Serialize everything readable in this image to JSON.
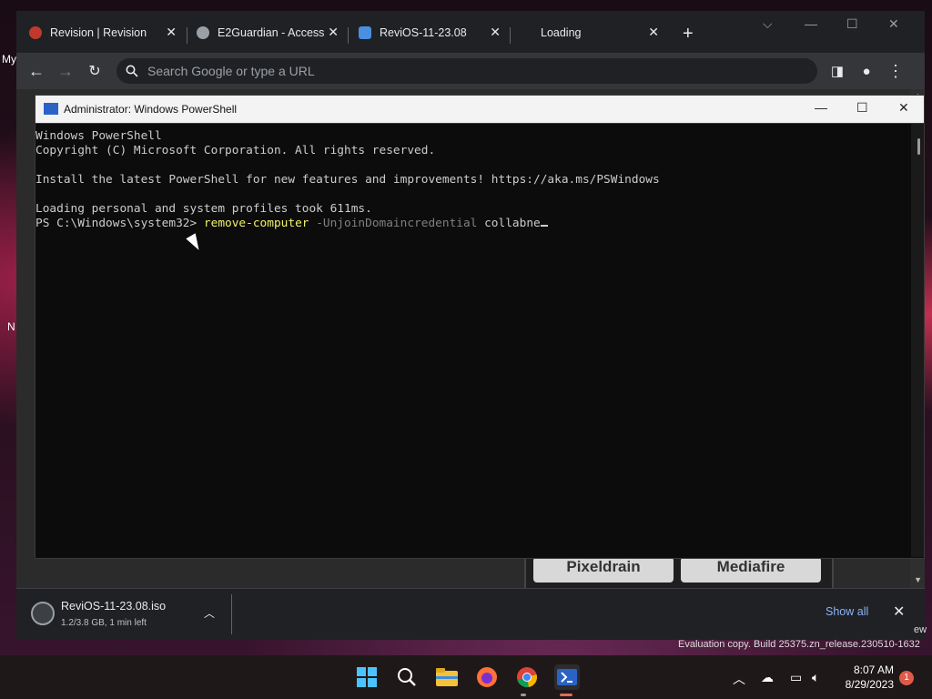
{
  "desktop": {
    "left_text_1": "My",
    "left_text_2": "N",
    "watermark": "Evaluation copy. Build 25375.zn_release.230510-1632",
    "watermark_right": "ew"
  },
  "browser": {
    "tabs": [
      {
        "title": "Revision | Revision",
        "active": false
      },
      {
        "title": "E2Guardian - Access",
        "active": false
      },
      {
        "title": "ReviOS-11-23.08",
        "active": true
      },
      {
        "title": "Loading",
        "active": false
      }
    ],
    "new_tab_label": "+",
    "omnibox_placeholder": "Search Google or type a URL",
    "site_buttons": [
      "Pixeldrain",
      "Mediafire"
    ]
  },
  "downloads": {
    "filename": "ReviOS-11-23.08.iso",
    "status": "1.2/3.8 GB, 1 min left",
    "show_all": "Show all"
  },
  "powershell": {
    "title": "Administrator: Windows PowerShell",
    "lines": [
      "Windows PowerShell",
      "Copyright (C) Microsoft Corporation. All rights reserved.",
      "",
      "Install the latest PowerShell for new features and improvements! https://aka.ms/PSWindows",
      "",
      "Loading personal and system profiles took 611ms."
    ],
    "prompt": "PS C:\\Windows\\system32> ",
    "command": "remove-computer",
    "parameter": " -UnjoinDomaincredential",
    "argument": " collabne"
  },
  "taskbar": {
    "time": "8:07 AM",
    "date": "8/29/2023",
    "notification_count": "1"
  }
}
